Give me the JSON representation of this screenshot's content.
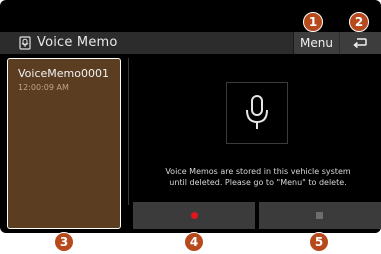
{
  "header": {
    "title": "Voice Memo",
    "menu_label": "Menu",
    "title_icon": "voice-memo-icon",
    "back_icon": "back-arrow-icon"
  },
  "memo_list": {
    "items": [
      {
        "name": "VoiceMemo0001",
        "time": "12:00:09 AM"
      }
    ]
  },
  "main": {
    "mic_icon": "microphone-icon",
    "info_text_line1": "Voice Memos are stored in this vehicle system",
    "info_text_line2": "until deleted. Please go to \"Menu\" to delete."
  },
  "controls": {
    "record_icon": "record-icon",
    "stop_icon": "stop-icon"
  },
  "callouts": [
    "1",
    "2",
    "3",
    "4",
    "5"
  ],
  "colors": {
    "background": "#000000",
    "header": "#2c2c2c",
    "list_selected": "#5b3d22",
    "button": "#3b3b3b",
    "record": "#e2141c",
    "callout": "#b74a1c"
  }
}
